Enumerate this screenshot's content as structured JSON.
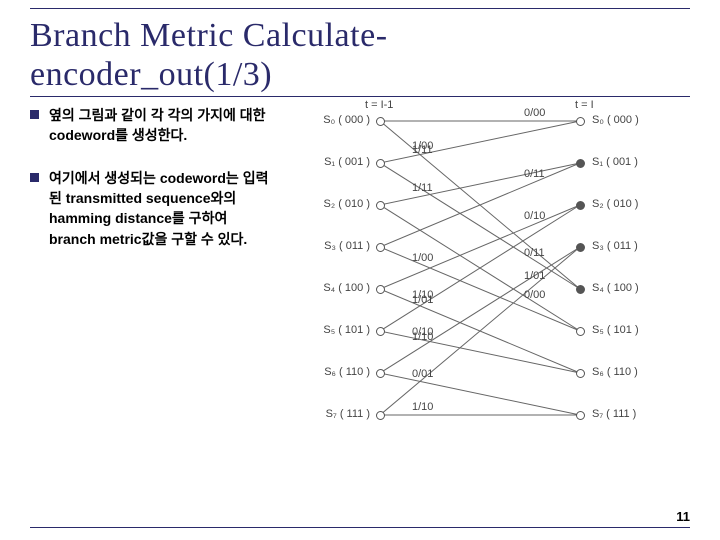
{
  "title_line1": "Branch Metric Calculate-",
  "title_line2": "encoder_out(1/3)",
  "bullets": [
    "옆의 그림과 같이 각 각의 가지에 대한 codeword를 생성한다.",
    "여기에서 생성되는 codeword는 입력된 transmitted sequence와의 hamming distance를 구하여 branch metric값을 구할 수 있다."
  ],
  "time_left": "t = I-1",
  "time_right": "t = I",
  "states_left": [
    {
      "name": "S₀",
      "bits": "000"
    },
    {
      "name": "S₁",
      "bits": "001"
    },
    {
      "name": "S₂",
      "bits": "010"
    },
    {
      "name": "S₃",
      "bits": "011"
    },
    {
      "name": "S₄",
      "bits": "100"
    },
    {
      "name": "S₅",
      "bits": "101"
    },
    {
      "name": "S₆",
      "bits": "110"
    },
    {
      "name": "S₇",
      "bits": "111"
    }
  ],
  "states_right": [
    {
      "name": "S₀",
      "bits": "000"
    },
    {
      "name": "S₁",
      "bits": "001"
    },
    {
      "name": "S₂",
      "bits": "010"
    },
    {
      "name": "S₃",
      "bits": "011"
    },
    {
      "name": "S₄",
      "bits": "100"
    },
    {
      "name": "S₅",
      "bits": "101"
    },
    {
      "name": "S₆",
      "bits": "110"
    },
    {
      "name": "S₇",
      "bits": "111"
    }
  ],
  "edges": [
    {
      "from": 0,
      "to": 0,
      "lab": "0/00",
      "side": "right"
    },
    {
      "from": 0,
      "to": 4,
      "lab": "1/11",
      "side": "left"
    },
    {
      "from": 1,
      "to": 0,
      "lab": "1/00",
      "side": "left"
    },
    {
      "from": 1,
      "to": 4,
      "lab": "0/11",
      "side": "right"
    },
    {
      "from": 2,
      "to": 5,
      "lab": "0/00",
      "side": "right"
    },
    {
      "from": 2,
      "to": 1,
      "lab": "1/11",
      "side": "left"
    },
    {
      "from": 3,
      "to": 1,
      "lab": "0/11",
      "side": "right"
    },
    {
      "from": 3,
      "to": 5,
      "lab": "1/00",
      "side": "left"
    },
    {
      "from": 4,
      "to": 2,
      "lab": "0/10",
      "side": "right"
    },
    {
      "from": 4,
      "to": 6,
      "lab": "1/01",
      "side": "left"
    },
    {
      "from": 5,
      "to": 2,
      "lab": "1/10",
      "side": "left"
    },
    {
      "from": 5,
      "to": 6,
      "lab": "0/10",
      "side": "left"
    },
    {
      "from": 6,
      "to": 3,
      "lab": "1/10",
      "side": "left"
    },
    {
      "from": 6,
      "to": 7,
      "lab": "0/01",
      "side": "left"
    },
    {
      "from": 7,
      "to": 3,
      "lab": "1/01",
      "side": "right"
    },
    {
      "from": 7,
      "to": 7,
      "lab": "1/10",
      "side": "left"
    }
  ],
  "page_number": "11",
  "chart_data": {
    "type": "table",
    "description": "Trellis diagram branch labels (input/output) from state at t=I-1 to state at t=I",
    "states": [
      "000",
      "001",
      "010",
      "011",
      "100",
      "101",
      "110",
      "111"
    ],
    "branches": [
      {
        "from": "000",
        "to": "000",
        "label": "0/00"
      },
      {
        "from": "000",
        "to": "100",
        "label": "1/11"
      },
      {
        "from": "001",
        "to": "000",
        "label": "1/00"
      },
      {
        "from": "001",
        "to": "100",
        "label": "0/11"
      },
      {
        "from": "010",
        "to": "101",
        "label": "0/00"
      },
      {
        "from": "010",
        "to": "001",
        "label": "1/11"
      },
      {
        "from": "011",
        "to": "001",
        "label": "0/11"
      },
      {
        "from": "011",
        "to": "101",
        "label": "1/00"
      },
      {
        "from": "100",
        "to": "010",
        "label": "0/10"
      },
      {
        "from": "100",
        "to": "110",
        "label": "1/01"
      },
      {
        "from": "101",
        "to": "010",
        "label": "1/10"
      },
      {
        "from": "101",
        "to": "110",
        "label": "0/10"
      },
      {
        "from": "110",
        "to": "011",
        "label": "1/10"
      },
      {
        "from": "110",
        "to": "111",
        "label": "0/01"
      },
      {
        "from": "111",
        "to": "011",
        "label": "1/01"
      },
      {
        "from": "111",
        "to": "111",
        "label": "1/10"
      }
    ]
  }
}
